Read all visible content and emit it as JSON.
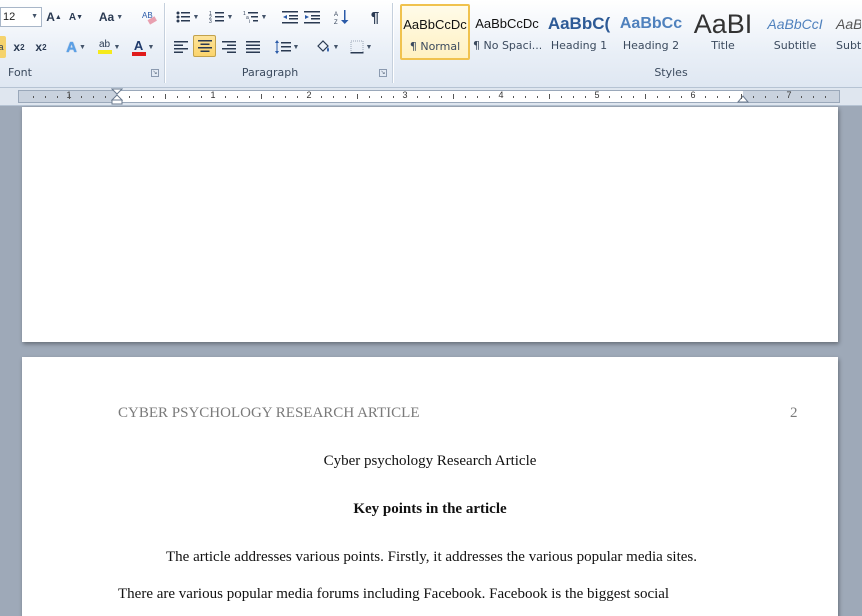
{
  "ribbon": {
    "font_size_value": "12",
    "groups": {
      "font": "Font",
      "paragraph": "Paragraph",
      "styles": "Styles"
    },
    "font_buttons": {
      "grow": "A",
      "shrink": "A",
      "change_case": "Aa",
      "subscript": "x",
      "superscript": "x",
      "text_effects": "A",
      "highlight": "ab",
      "font_color": "A"
    },
    "paragraph_buttons": {
      "show_marks": "¶"
    },
    "styles_gallery": [
      {
        "sample": "AaBbCcDc",
        "name": "¶ Normal",
        "selected": true
      },
      {
        "sample": "AaBbCcDc",
        "name": "¶ No Spaci...",
        "selected": false
      },
      {
        "sample": "AaBbC(",
        "name": "Heading 1",
        "selected": false
      },
      {
        "sample": "AaBbCc",
        "name": "Heading 2",
        "selected": false
      },
      {
        "sample": "AaBI",
        "name": "Title",
        "selected": false
      },
      {
        "sample": "AaBbCcI",
        "name": "Subtitle",
        "selected": false
      },
      {
        "sample": "AaBb",
        "name": "Subt",
        "selected": false
      }
    ],
    "colors": {
      "highlight": "#f5ea1c",
      "font_color": "#e01b1b",
      "selected_style_border": "#f0c24e"
    }
  },
  "ruler": {
    "numbers": [
      "1",
      "1",
      "2",
      "3",
      "4",
      "5",
      "6",
      "7"
    ]
  },
  "document": {
    "header_running_head": "CYBER PSYCHOLOGY RESEARCH ARTICLE",
    "page_number": "2",
    "title": "Cyber psychology Research Article",
    "heading": "Key points in the article",
    "paragraph_1": "The article addresses various points. Firstly, it addresses the various popular media sites.",
    "paragraph_2": "There are various popular media forums including Facebook. Facebook is the biggest social"
  }
}
